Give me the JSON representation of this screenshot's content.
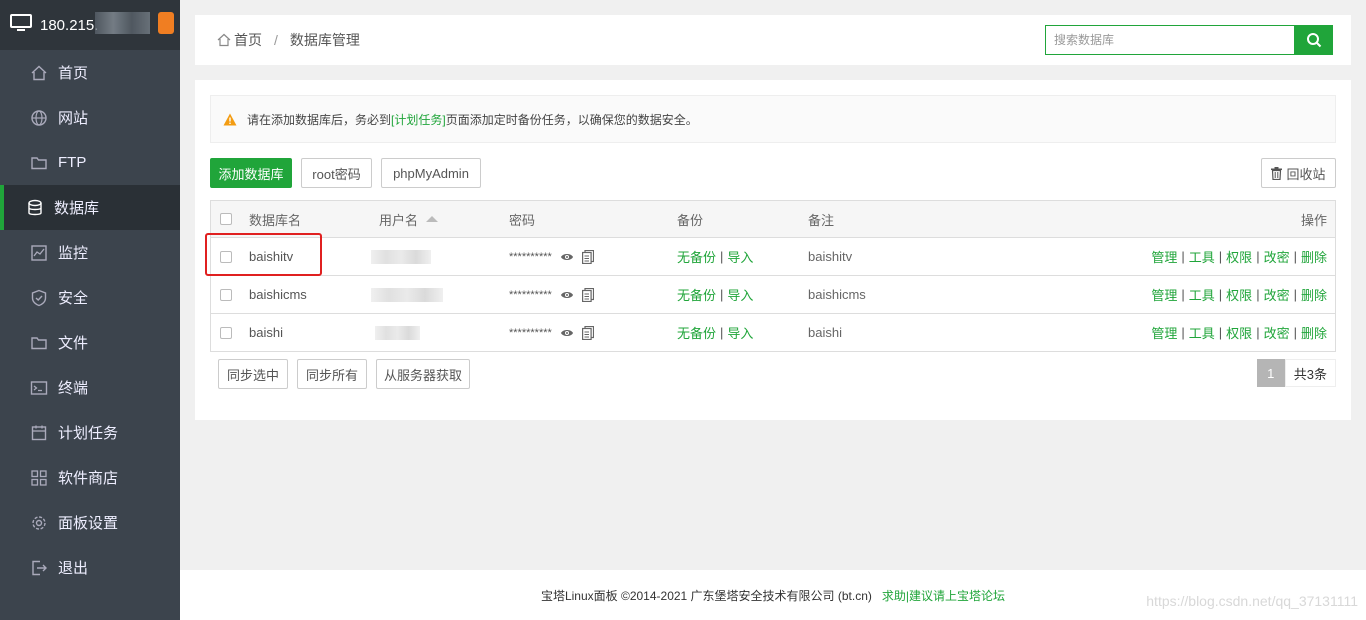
{
  "sidebar": {
    "ip": "180.215.",
    "items": [
      {
        "label": "首页",
        "icon": "home-icon"
      },
      {
        "label": "网站",
        "icon": "globe-icon"
      },
      {
        "label": "FTP",
        "icon": "ftp-icon"
      },
      {
        "label": "数据库",
        "icon": "database-icon",
        "active": true
      },
      {
        "label": "监控",
        "icon": "monitor-icon"
      },
      {
        "label": "安全",
        "icon": "shield-icon"
      },
      {
        "label": "文件",
        "icon": "folder-icon"
      },
      {
        "label": "终端",
        "icon": "terminal-icon"
      },
      {
        "label": "计划任务",
        "icon": "calendar-icon"
      },
      {
        "label": "软件商店",
        "icon": "grid-icon"
      },
      {
        "label": "面板设置",
        "icon": "gear-icon"
      },
      {
        "label": "退出",
        "icon": "logout-icon"
      }
    ]
  },
  "breadcrumb": {
    "home": "首页",
    "separator": "/",
    "current": "数据库管理"
  },
  "search": {
    "placeholder": "搜索数据库"
  },
  "alert": {
    "before": "请在添加数据库后，务必到",
    "link": "[计划任务]",
    "after": "页面添加定时备份任务，以确保您的数据安全。"
  },
  "toolbar": {
    "add": "添加数据库",
    "root": "root密码",
    "phpmyadmin": "phpMyAdmin",
    "recycle": "回收站"
  },
  "table": {
    "headers": {
      "name": "数据库名",
      "user": "用户名",
      "password": "密码",
      "backup": "备份",
      "note": "备注",
      "ops": "操作"
    },
    "rows": [
      {
        "name": "baishitv",
        "password": "**********",
        "backup": "无备份",
        "import": "导入",
        "note": "baishitv"
      },
      {
        "name": "baishicms",
        "password": "**********",
        "backup": "无备份",
        "import": "导入",
        "note": "baishicms"
      },
      {
        "name": "baishi",
        "password": "**********",
        "backup": "无备份",
        "import": "导入",
        "note": "baishi"
      }
    ],
    "ops": [
      "管理",
      "工具",
      "权限",
      "改密",
      "删除"
    ]
  },
  "bottom": {
    "sync_selected": "同步选中",
    "sync_all": "同步所有",
    "fetch_server": "从服务器获取"
  },
  "pager": {
    "current": "1",
    "total": "共3条"
  },
  "footer": {
    "text": "宝塔Linux面板 ©2014-2021 广东堡塔安全技术有限公司 (bt.cn)",
    "link": "求助|建议请上宝塔论坛"
  },
  "watermark": "https://blog.csdn.net/qq_37131111",
  "colors": {
    "accent": "#20a53a",
    "sidebar": "#3c444d",
    "highlight": "#e02020"
  }
}
